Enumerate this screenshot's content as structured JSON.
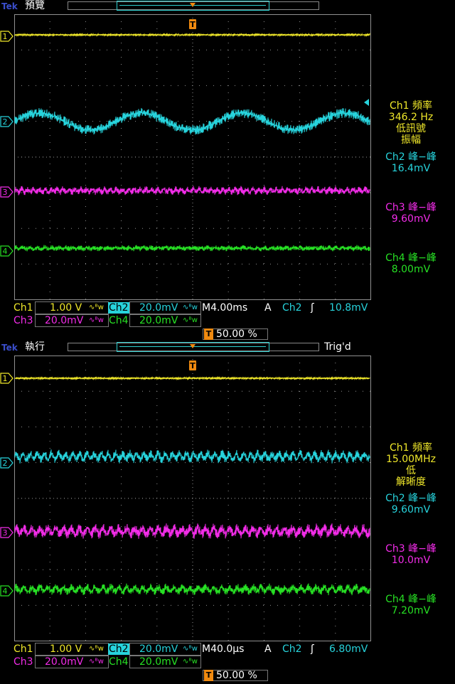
{
  "brand": "Tek",
  "colors": {
    "ch1": "#f0e82a",
    "ch2": "#27d3dc",
    "ch3": "#f22ce8",
    "ch4": "#27e024",
    "trigger": "#f08a10",
    "grid": "#909090",
    "text": "#ffffff"
  },
  "channel_markers": [
    "1",
    "2",
    "3",
    "4"
  ],
  "trigger_marker": "T",
  "screens": [
    {
      "mode": "預覽",
      "trigger_status": "",
      "measurements": {
        "ch1_label": "Ch1 頻率",
        "ch1_value": "346.2 Hz",
        "ch1_note_1": "低訊號",
        "ch1_note_2": "振幅",
        "ch2_label": "Ch2 峰−峰",
        "ch2_value": "16.4mV",
        "ch3_label": "Ch3 峰−峰",
        "ch3_value": "9.60mV",
        "ch4_label": "Ch4 峰−峰",
        "ch4_value": "8.00mV"
      },
      "status": {
        "ch1": "Ch1",
        "ch1_scale": "1.00 V",
        "ch2": "Ch2",
        "ch2_scale": "20.0mV",
        "ch3": "Ch3",
        "ch3_scale": "20.0mV",
        "ch4": "Ch4",
        "ch4_scale": "20.0mV",
        "bw_glyph": "∿ᴮw",
        "timebase": "M4.00ms",
        "acq": "A",
        "trig_source": "Ch2",
        "trig_slope": "ʃ",
        "trig_level": "10.8mV",
        "trig_pos_marker": "T",
        "trig_pos": "50.00 %"
      }
    },
    {
      "mode": "執行",
      "trigger_status": "Trig'd",
      "measurements": {
        "ch1_label": "Ch1 頻率",
        "ch1_value": "15.00MHz",
        "ch1_note_1": "低",
        "ch1_note_2": "解晰度",
        "ch2_label": "Ch2 峰−峰",
        "ch2_value": "9.60mV",
        "ch3_label": "Ch3 峰−峰",
        "ch3_value": "10.0mV",
        "ch4_label": "Ch4 峰−峰",
        "ch4_value": "7.20mV"
      },
      "status": {
        "ch1": "Ch1",
        "ch1_scale": "1.00 V",
        "ch2": "Ch2",
        "ch2_scale": "20.0mV",
        "ch3": "Ch3",
        "ch3_scale": "20.0mV",
        "ch4": "Ch4",
        "ch4_scale": "20.0mV",
        "bw_glyph": "∿ᴮw",
        "timebase": "M40.0µs",
        "acq": "A",
        "trig_source": "Ch2",
        "trig_slope": "ʃ",
        "trig_level": "6.80mV",
        "trig_pos_marker": "T",
        "trig_pos": "50.00 %"
      }
    }
  ]
}
